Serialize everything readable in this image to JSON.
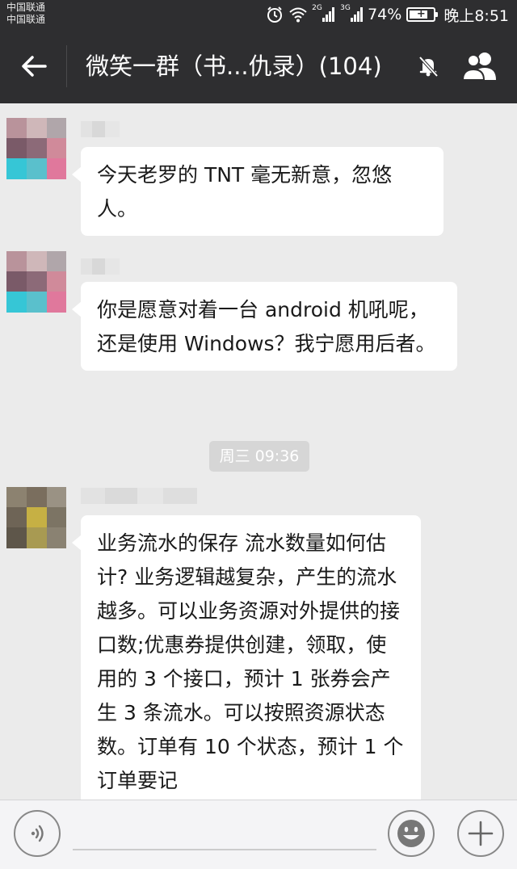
{
  "status_bar": {
    "carrier_1": "中国联通",
    "carrier_2": "中国联通",
    "net_1": "2G",
    "net_2": "3G",
    "battery": "74%",
    "time": "晚上8:51"
  },
  "header": {
    "title": "微笑一群（书...仇录）(104)",
    "icons": [
      "back-arrow-icon",
      "mute-bell-icon",
      "group-members-icon"
    ]
  },
  "messages": [
    {
      "text": "今天老罗的 TNT 毫无新意，忽悠人。"
    },
    {
      "text": "你是愿意对着一台 android 机吼呢，还是使用 Windows？我宁愿用后者。"
    },
    {
      "text": "业务流水的保存 流水数量如何估计? 业务逻辑越复杂，产生的流水越多。可以业务资源对外提供的接口数;优惠券提供创建，领取，使用的 3 个接口，预计 1 张券会产生 3 条流水。可以按照资源状态数。订单有 10 个状态，预计 1 个订单要记"
    }
  ],
  "timestamp": "周三 09:36",
  "input_bar": {
    "placeholder": "",
    "icons": [
      "voice-icon",
      "emoji-icon",
      "plus-icon"
    ]
  },
  "colors": {
    "header_bg": "#2e2e30",
    "chat_bg": "#ebebeb",
    "bubble_bg": "#ffffff"
  }
}
